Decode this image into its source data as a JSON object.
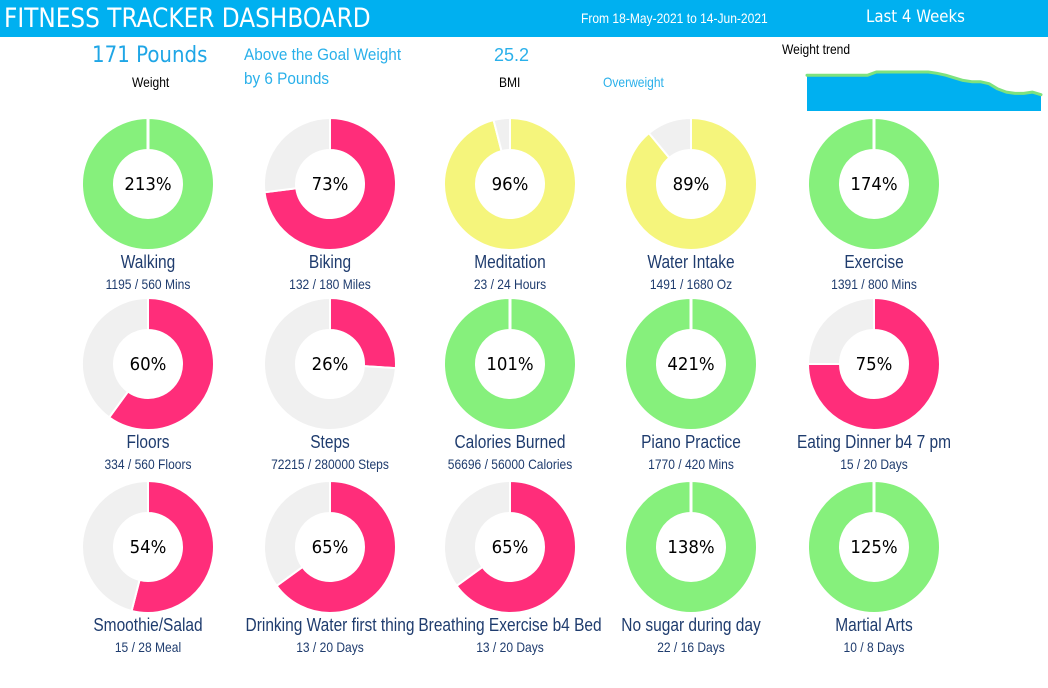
{
  "header": {
    "title": "FITNESS TRACKER DASHBOARD",
    "date_range": "From 18-May-2021 to 14-Jun-2021",
    "period": "Last 4 Weeks",
    "background_color": "#00b0f0"
  },
  "summary": {
    "weight_value": "171 Pounds",
    "weight_label": "Weight",
    "goal_message_line1": "Above the Goal Weight",
    "goal_message_line2": "by 6 Pounds",
    "bmi_value": "25.2",
    "bmi_label": "BMI",
    "bmi_category": "Overweight",
    "trend_label": "Weight trend"
  },
  "chart_data": {
    "type": "area",
    "title": "Weight trend",
    "x": [
      1,
      2,
      3,
      4,
      5,
      6,
      7,
      8,
      9,
      10,
      11,
      12,
      13,
      14,
      15,
      16,
      17,
      18,
      19,
      20,
      21,
      22,
      23,
      24,
      25,
      26,
      27,
      28
    ],
    "values": [
      177,
      177,
      177,
      177,
      177,
      177,
      177,
      177,
      178,
      178,
      178,
      178,
      178,
      178,
      178,
      177.6,
      177,
      176.2,
      175.4,
      175,
      175,
      174.4,
      172.8,
      171.8,
      171.4,
      171.4,
      171.8,
      171
    ],
    "series_color": "#00b0f0",
    "line_color": "#7ee27e",
    "xlabel": "",
    "ylabel": "",
    "grid": false
  },
  "colors": {
    "achieved": "#86f07c",
    "partial_high": "#f5f57c",
    "partial_low": "#ff2d7a",
    "remaining": "#f0f0f0"
  },
  "goals": [
    {
      "name": "Walking",
      "percent": 213,
      "percent_label": "213%",
      "detail": "1195 / 560 Mins",
      "status": "achieved"
    },
    {
      "name": "Biking",
      "percent": 73,
      "percent_label": "73%",
      "detail": "132 / 180 Miles",
      "status": "partial_low"
    },
    {
      "name": "Meditation",
      "percent": 96,
      "percent_label": "96%",
      "detail": "23 / 24 Hours",
      "status": "partial_high"
    },
    {
      "name": "Water Intake",
      "percent": 89,
      "percent_label": "89%",
      "detail": "1491 / 1680 Oz",
      "status": "partial_high"
    },
    {
      "name": "Exercise",
      "percent": 174,
      "percent_label": "174%",
      "detail": "1391 / 800 Mins",
      "status": "achieved"
    },
    {
      "name": "Floors",
      "percent": 60,
      "percent_label": "60%",
      "detail": "334 / 560 Floors",
      "status": "partial_low"
    },
    {
      "name": "Steps",
      "percent": 26,
      "percent_label": "26%",
      "detail": "72215 / 280000 Steps",
      "status": "partial_low"
    },
    {
      "name": "Calories Burned",
      "percent": 101,
      "percent_label": "101%",
      "detail": "56696 / 56000 Calories",
      "status": "achieved"
    },
    {
      "name": "Piano Practice",
      "percent": 421,
      "percent_label": "421%",
      "detail": "1770 / 420 Mins",
      "status": "achieved"
    },
    {
      "name": "Eating Dinner b4 7 pm",
      "percent": 75,
      "percent_label": "75%",
      "detail": "15 / 20 Days",
      "status": "partial_low"
    },
    {
      "name": "Smoothie/Salad",
      "percent": 54,
      "percent_label": "54%",
      "detail": "15 / 28 Meal",
      "status": "partial_low"
    },
    {
      "name": "Drinking Water first thing",
      "percent": 65,
      "percent_label": "65%",
      "detail": "13 / 20 Days",
      "status": "partial_low"
    },
    {
      "name": "Breathing Exercise b4 Bed",
      "percent": 65,
      "percent_label": "65%",
      "detail": "13 / 20 Days",
      "status": "partial_low"
    },
    {
      "name": "No sugar during day",
      "percent": 138,
      "percent_label": "138%",
      "detail": "22 / 16 Days",
      "status": "achieved"
    },
    {
      "name": "Martial Arts",
      "percent": 125,
      "percent_label": "125%",
      "detail": "10 / 8 Days",
      "status": "achieved"
    }
  ]
}
